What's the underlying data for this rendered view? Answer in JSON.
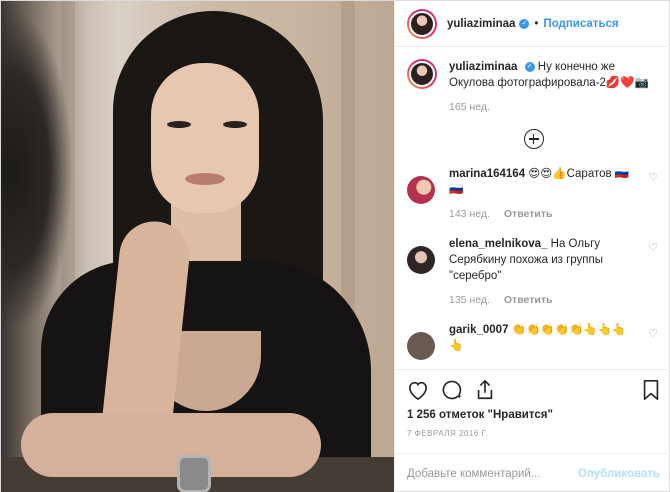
{
  "post": {
    "username": "yuliaziminaa",
    "verified_mark": "✓",
    "separator": "•",
    "follow_label": "Подписаться",
    "caption_text": "Ну конечно же Окулова фотографировала-2💋❤️📷",
    "caption_time": "165 нед.",
    "likes": "1 256 отметок \"Нравится\"",
    "date": "7 февраля 2016 г."
  },
  "comments": [
    {
      "username": "marina164164",
      "text": "😍😍👍Саратов 🇷🇺🇷🇺",
      "time": "143 нед.",
      "reply": "Ответить"
    },
    {
      "username": "elena_melnikova_",
      "text": "На Ольгу Серябкину похожа из группы \"серебро\"",
      "time": "135 нед.",
      "reply": "Ответить"
    },
    {
      "username": "garik_0007",
      "text": "👏👏👏👏👏👆👆👆👆",
      "time": "",
      "reply": ""
    }
  ],
  "composer": {
    "placeholder": "Добавьте комментарий...",
    "publish_label": "Опубликовать"
  },
  "icons": {
    "like": "heart-icon",
    "comment": "comment-icon",
    "share": "share-icon",
    "save": "bookmark-icon",
    "more_comments": "plus-circle-icon",
    "comment_like": "heart-small-icon"
  },
  "colors": {
    "link_blue": "#3897f0",
    "publish_disabled": "#b2dffc",
    "meta_gray": "#999999",
    "border": "#efefef"
  }
}
